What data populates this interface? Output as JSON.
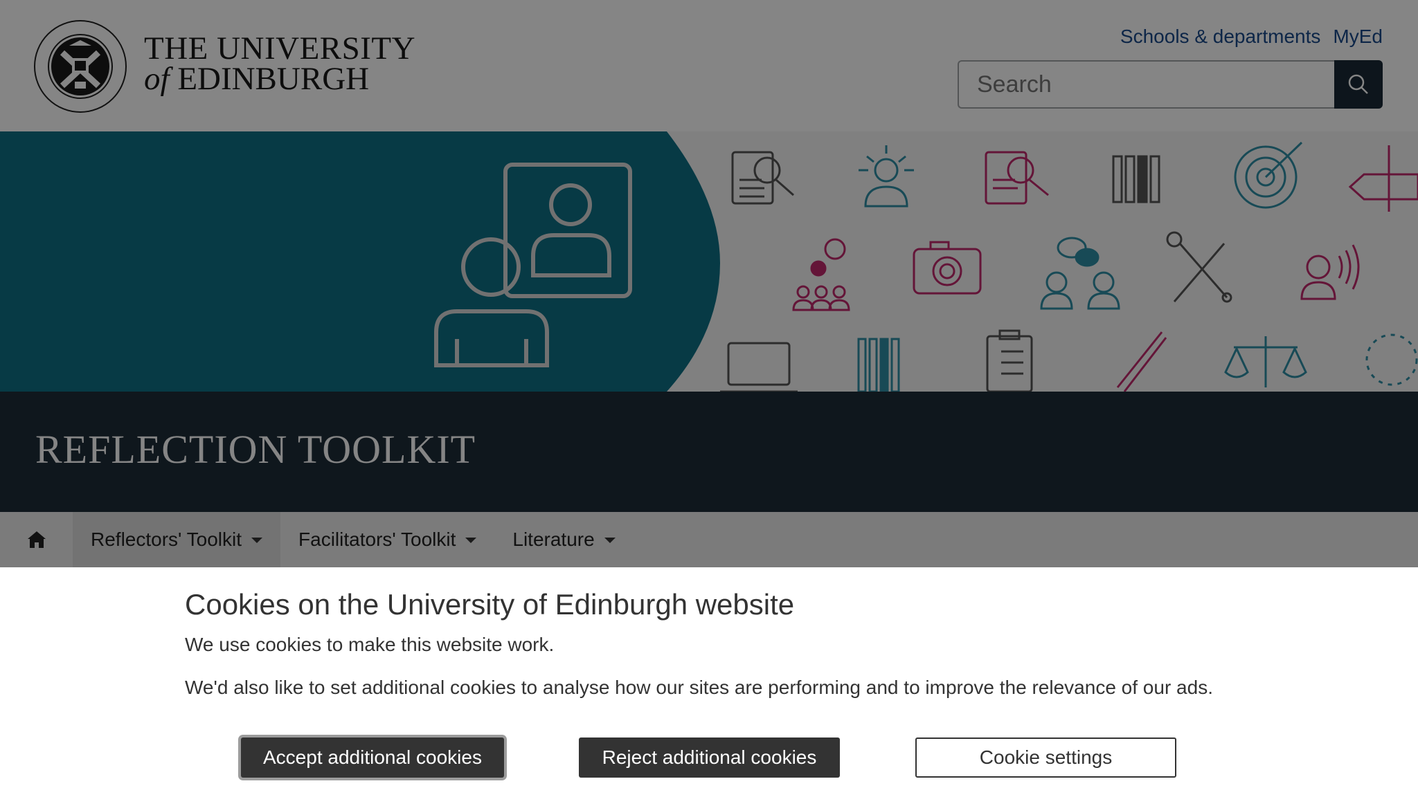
{
  "header": {
    "university_line1": "THE UNIVERSITY",
    "university_of": "of",
    "university_line2": "EDINBURGH",
    "links": [
      "Schools & departments",
      "MyEd"
    ],
    "search_placeholder": "Search"
  },
  "banner": {
    "icon": "reflection-person-icon"
  },
  "site_title": "REFLECTION TOOLKIT",
  "nav": {
    "home_icon": "home-icon",
    "items": [
      {
        "label": "Reflectors' Toolkit"
      },
      {
        "label": "Facilitators' Toolkit"
      },
      {
        "label": "Literature"
      }
    ]
  },
  "cookie": {
    "heading": "Cookies on the University of Edinburgh website",
    "text1": "We use cookies to make this website work.",
    "text2": "We'd also like to set additional cookies to analyse how our sites are performing and to improve the relevance of our ads.",
    "accept_label": "Accept additional cookies",
    "reject_label": "Reject additional cookies",
    "settings_label": "Cookie settings"
  },
  "colors": {
    "teal": "#0f6f84",
    "navy": "#1d2c38",
    "pink": "#c0296c",
    "nav_bg": "#ececec"
  }
}
